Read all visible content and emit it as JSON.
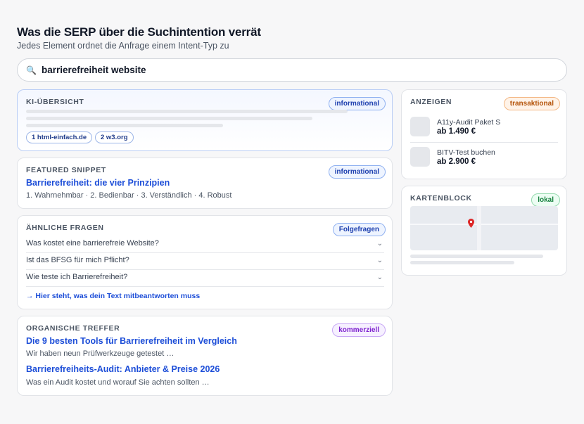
{
  "header": {
    "title": "Was die SERP über die Suchintention verrät",
    "subtitle": "Jedes Element ordnet die Anfrage einem Intent-Typ zu"
  },
  "search": {
    "icon": "magnifier-icon",
    "query": "barrierefreiheit website"
  },
  "ai_overview": {
    "heading": "KI-ÜBERSICHT",
    "badge": "informational",
    "sources": [
      "1 html-einfach.de",
      "2 w3.org"
    ]
  },
  "featured_snippet": {
    "heading": "FEATURED SNIPPET",
    "badge": "informational",
    "title": "Barrierefreiheit: die vier Prinzipien",
    "text": "1. Wahrnehmbar · 2. Bedienbar · 3. Verständlich · 4. Robust"
  },
  "related_questions": {
    "heading": "ÄHNLICHE FRAGEN",
    "badge": "Folgefragen",
    "items": [
      "Was kostet eine barrierefreie Website?",
      "Ist das BFSG für mich Pflicht?",
      "Wie teste ich Barrierefreiheit?"
    ],
    "chevron": "⌄",
    "note": "→ Hier steht, was dein Text mitbeantworten muss"
  },
  "organic": {
    "heading": "ORGANISCHE TREFFER",
    "badge": "kommerziell",
    "results": [
      {
        "title": "Die 9 besten Tools für Barrierefreiheit im Vergleich",
        "snippet": "Wir haben neun Prüfwerkzeuge getestet …"
      },
      {
        "title": "Barrierefreiheits-Audit: Anbieter & Preise 2026",
        "snippet": "Was ein Audit kostet und worauf Sie achten sollten …"
      }
    ]
  },
  "ads": {
    "heading": "ANZEIGEN",
    "badge": "transaktional",
    "items": [
      {
        "name": "A11y-Audit Paket S",
        "price": "ab 1.490 €"
      },
      {
        "name": "BITV-Test buchen",
        "price": "ab 2.900 €"
      }
    ]
  },
  "map": {
    "heading": "KARTENBLOCK",
    "badge": "lokal"
  },
  "colors": {
    "informational": "#1e40af",
    "transaktional": "#b45309",
    "lokal": "#15803d",
    "kommerziell": "#7e22ce",
    "link": "#1d4ed8"
  }
}
